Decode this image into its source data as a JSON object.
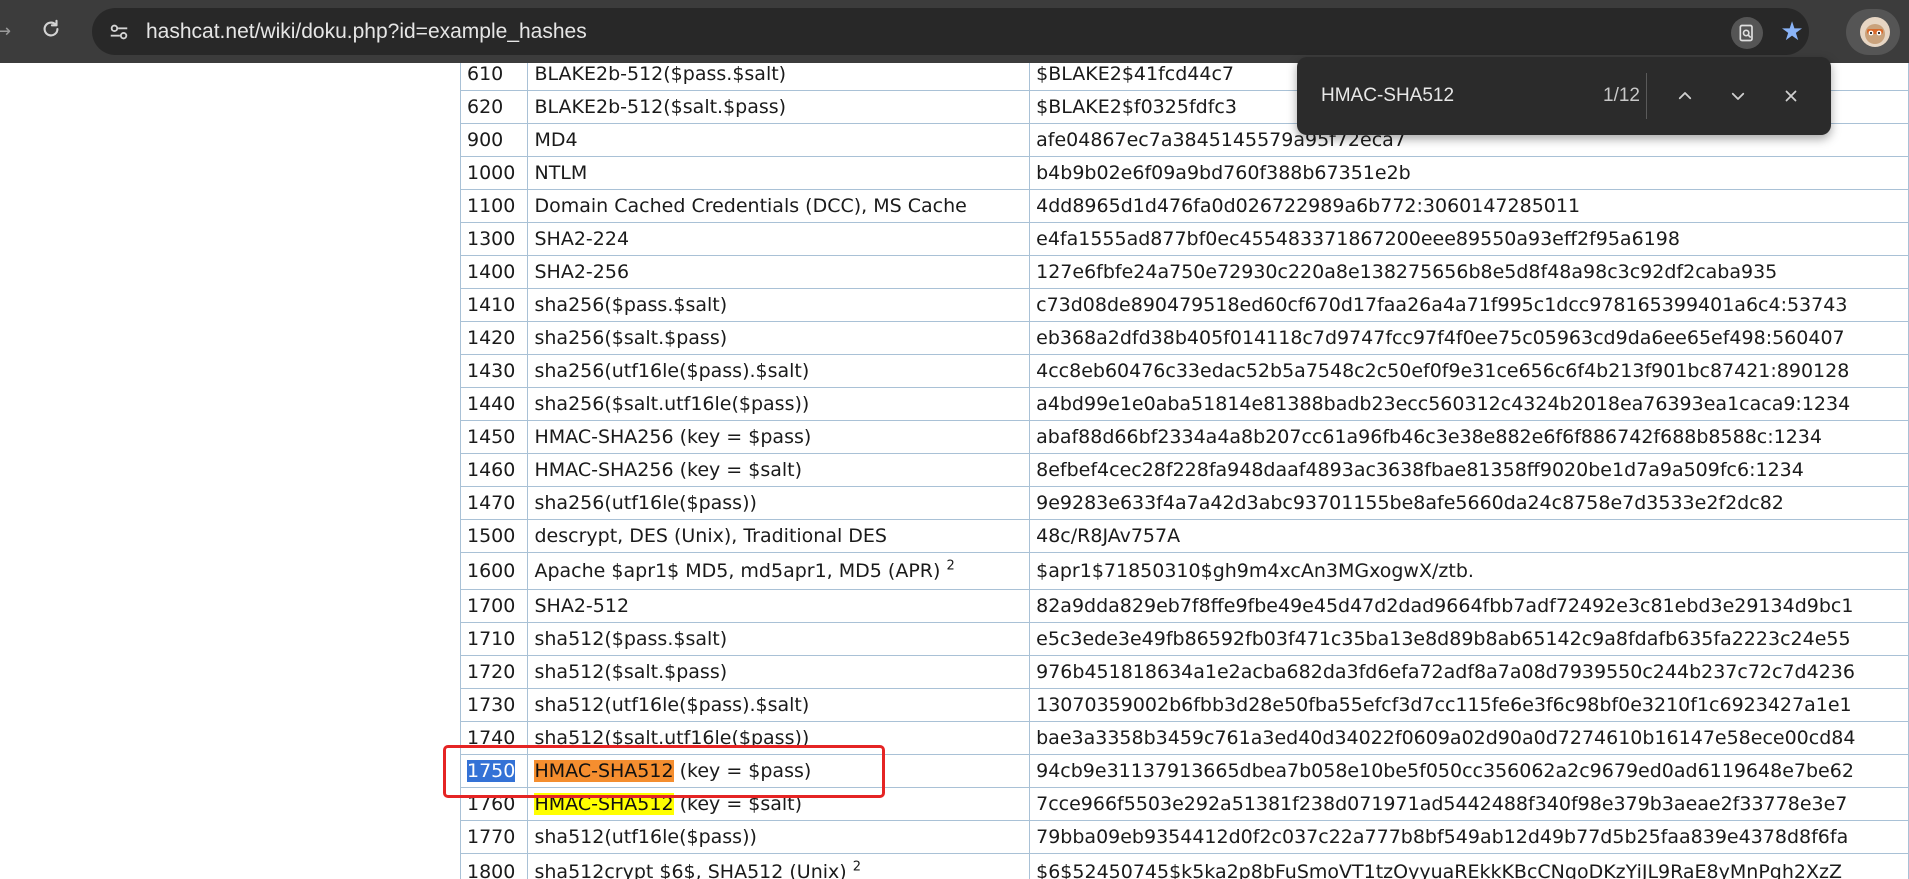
{
  "browser": {
    "url": "hashcat.net/wiki/doku.php?id=example_hashes",
    "icons": {
      "reload": "reload-icon",
      "site_info": "tune-icon",
      "lens": "google-lens-icon",
      "bookmark": "star-icon",
      "profile": "avatar"
    }
  },
  "find_bar": {
    "query": "HMAC-SHA512",
    "count": "1/12",
    "icons": [
      "chevron-up-icon",
      "chevron-down-icon",
      "close-icon"
    ]
  },
  "table": {
    "rows": [
      {
        "mode": "610",
        "name": "BLAKE2b-512($pass.$salt)",
        "example": "$BLAKE2$41fcd44c7"
      },
      {
        "mode": "620",
        "name": "BLAKE2b-512($salt.$pass)",
        "example": "$BLAKE2$f0325fdfc3"
      },
      {
        "mode": "900",
        "name": "MD4",
        "example": "afe04867ec7a3845145579a95f72eca7"
      },
      {
        "mode": "1000",
        "name": "NTLM",
        "example": "b4b9b02e6f09a9bd760f388b67351e2b"
      },
      {
        "mode": "1100",
        "name": "Domain Cached Credentials (DCC), MS Cache",
        "example": "4dd8965d1d476fa0d026722989a6b772:3060147285011"
      },
      {
        "mode": "1300",
        "name": "SHA2-224",
        "example": "e4fa1555ad877bf0ec455483371867200eee89550a93eff2f95a6198"
      },
      {
        "mode": "1400",
        "name": "SHA2-256",
        "example": "127e6fbfe24a750e72930c220a8e138275656b8e5d8f48a98c3c92df2caba935"
      },
      {
        "mode": "1410",
        "name": "sha256($pass.$salt)",
        "example": "c73d08de890479518ed60cf670d17faa26a4a71f995c1dcc978165399401a6c4:53743"
      },
      {
        "mode": "1420",
        "name": "sha256($salt.$pass)",
        "example": "eb368a2dfd38b405f014118c7d9747fcc97f4f0ee75c05963cd9da6ee65ef498:560407"
      },
      {
        "mode": "1430",
        "name": "sha256(utf16le($pass).$salt)",
        "example": "4cc8eb60476c33edac52b5a7548c2c50ef0f9e31ce656c6f4b213f901bc87421:890128"
      },
      {
        "mode": "1440",
        "name": "sha256($salt.utf16le($pass))",
        "example": "a4bd99e1e0aba51814e81388badb23ecc560312c4324b2018ea76393ea1caca9:1234"
      },
      {
        "mode": "1450",
        "name": "HMAC-SHA256 (key = $pass)",
        "example": "abaf88d66bf2334a4a8b207cc61a96fb46c3e38e882e6f6f886742f688b8588c:1234"
      },
      {
        "mode": "1460",
        "name": "HMAC-SHA256 (key = $salt)",
        "example": "8efbef4cec28f228fa948daaf4893ac3638fbae81358ff9020be1d7a9a509fc6:1234"
      },
      {
        "mode": "1470",
        "name": "sha256(utf16le($pass))",
        "example": "9e9283e633f4a7a42d3abc93701155be8afe5660da24c8758e7d3533e2f2dc82"
      },
      {
        "mode": "1500",
        "name": "descrypt, DES (Unix), Traditional DES",
        "example": "48c/R8JAv757A"
      },
      {
        "mode": "1600",
        "name": "Apache $apr1$ MD5, md5apr1, MD5 (APR)",
        "note": "2",
        "example": "$apr1$71850310$gh9m4xcAn3MGxogwX/ztb."
      },
      {
        "mode": "1700",
        "name": "SHA2-512",
        "example": "82a9dda829eb7f8ffe9fbe49e45d47d2dad9664fbb7adf72492e3c81ebd3e29134d9bc1"
      },
      {
        "mode": "1710",
        "name": "sha512($pass.$salt)",
        "example": "e5c3ede3e49fb86592fb03f471c35ba13e8d89b8ab65142c9a8fdafb635fa2223c24e55"
      },
      {
        "mode": "1720",
        "name": "sha512($salt.$pass)",
        "example": "976b451818634a1e2acba682da3fd6efa72adf8a7a08d7939550c244b237c72c7d4236"
      },
      {
        "mode": "1730",
        "name": "sha512(utf16le($pass).$salt)",
        "example": "13070359002b6fbb3d28e50fba55efcf3d7cc115fe6e3f6c98bf0e3210f1c6923427a1e1"
      },
      {
        "mode": "1740",
        "name": "sha512($salt.utf16le($pass))",
        "example": "bae3a3358b3459c761a3ed40d34022f0609a02d90a0d7274610b16147e58ece00cd84"
      },
      {
        "mode": "1750",
        "name_pre": "",
        "name_match": "HMAC-SHA512",
        "name_post": " (key = $pass)",
        "example": "94cb9e31137913665dbea7b058e10be5f050cc356062a2c9679ed0ad6119648e7be62"
      },
      {
        "mode": "1760",
        "name_pre": "",
        "name_match": "HMAC-SHA512",
        "name_post": " (key = $salt)",
        "example": "7cce966f5503e292a51381f238d071971ad5442488f340f98e379b3aeae2f33778e3e7"
      },
      {
        "mode": "1770",
        "name": "sha512(utf16le($pass))",
        "example": "79bba09eb9354412d0f2c037c22a777b8bf549ab12d49b77d5b25faa839e4378d8f6fa"
      },
      {
        "mode": "1800",
        "name": "sha512crypt $6$, SHA512 (Unix)",
        "note": "2",
        "example": "$6$52450745$k5ka2p8bFuSmoVT1tzOyyuaREkkKBcCNqoDKzYiJL9RaE8yMnPgh2XzZ"
      }
    ]
  },
  "colors": {
    "chrome_bg": "#3c3c3c",
    "omnibox_bg": "#282828",
    "table_border": "#a9c1d6",
    "active_match": "#f58e2f",
    "other_match": "#ffff00",
    "selection": "#3472d6",
    "annotation": "#e52424"
  }
}
